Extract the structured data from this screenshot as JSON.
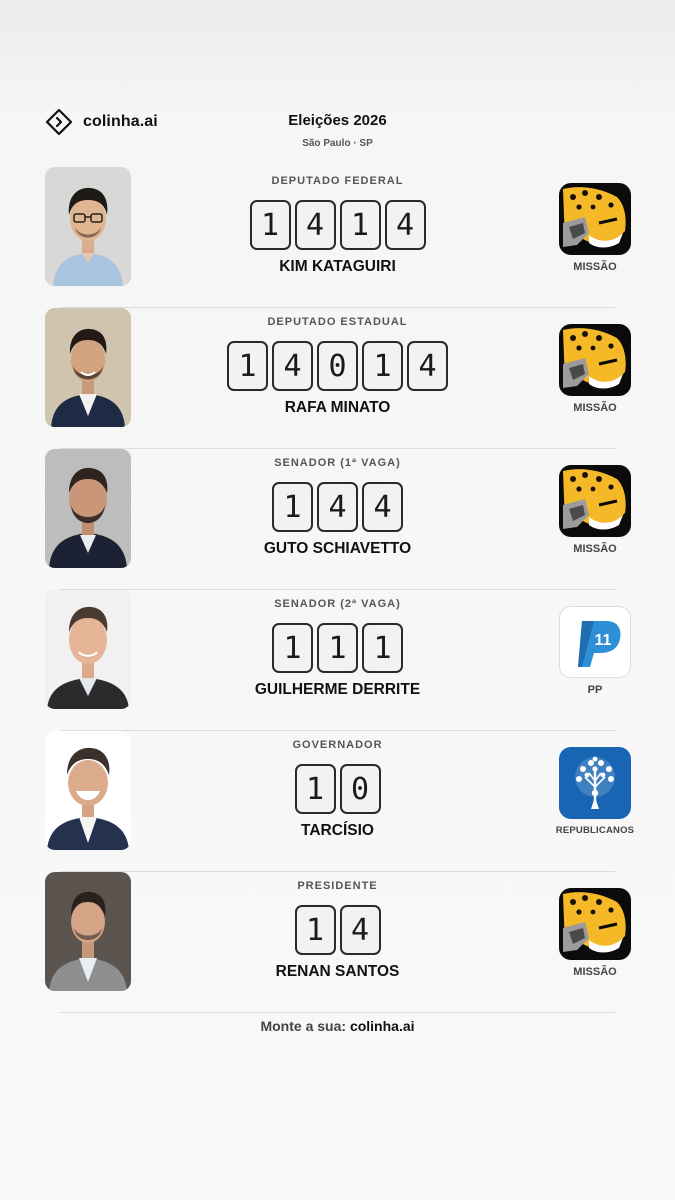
{
  "brand": {
    "name": "colinha.ai",
    "logo_icon": "diamond-chevron-icon"
  },
  "header": {
    "title": "Eleições 2026",
    "subtitle": "São Paulo · SP"
  },
  "ballot": [
    {
      "office": "DEPUTADO FEDERAL",
      "number": [
        "1",
        "4",
        "1",
        "4"
      ],
      "name": "KIM KATAGUIRI",
      "party": "MISSÃO",
      "party_logo": "jaguar-logo"
    },
    {
      "office": "DEPUTADO ESTADUAL",
      "number": [
        "1",
        "4",
        "0",
        "1",
        "4"
      ],
      "name": "RAFA MINATO",
      "party": "MISSÃO",
      "party_logo": "jaguar-logo"
    },
    {
      "office": "SENADOR (1ª VAGA)",
      "number": [
        "1",
        "4",
        "4"
      ],
      "name": "GUTO SCHIAVETTO",
      "party": "MISSÃO",
      "party_logo": "jaguar-logo"
    },
    {
      "office": "SENADOR (2ª VAGA)",
      "number": [
        "1",
        "1",
        "1"
      ],
      "name": "GUILHERME DERRITE",
      "party": "PP",
      "party_logo": "pp-logo",
      "party_logo_text": "11"
    },
    {
      "office": "GOVERNADOR",
      "number": [
        "1",
        "0"
      ],
      "name": "TARCÍSIO",
      "party": "REPUBLICANOS",
      "party_logo": "republicanos-tree-logo"
    },
    {
      "office": "PRESIDENTE",
      "number": [
        "1",
        "4"
      ],
      "name": "RENAN SANTOS",
      "party": "MISSÃO",
      "party_logo": "jaguar-logo"
    }
  ],
  "footer": {
    "prefix": "Monte a sua:",
    "link": "colinha.ai"
  },
  "colors": {
    "accent_text": "#111111",
    "jaguar_yellow": "#f5b928",
    "pp_blue": "#2d8fd5",
    "republicanos_blue": "#1765b3"
  }
}
